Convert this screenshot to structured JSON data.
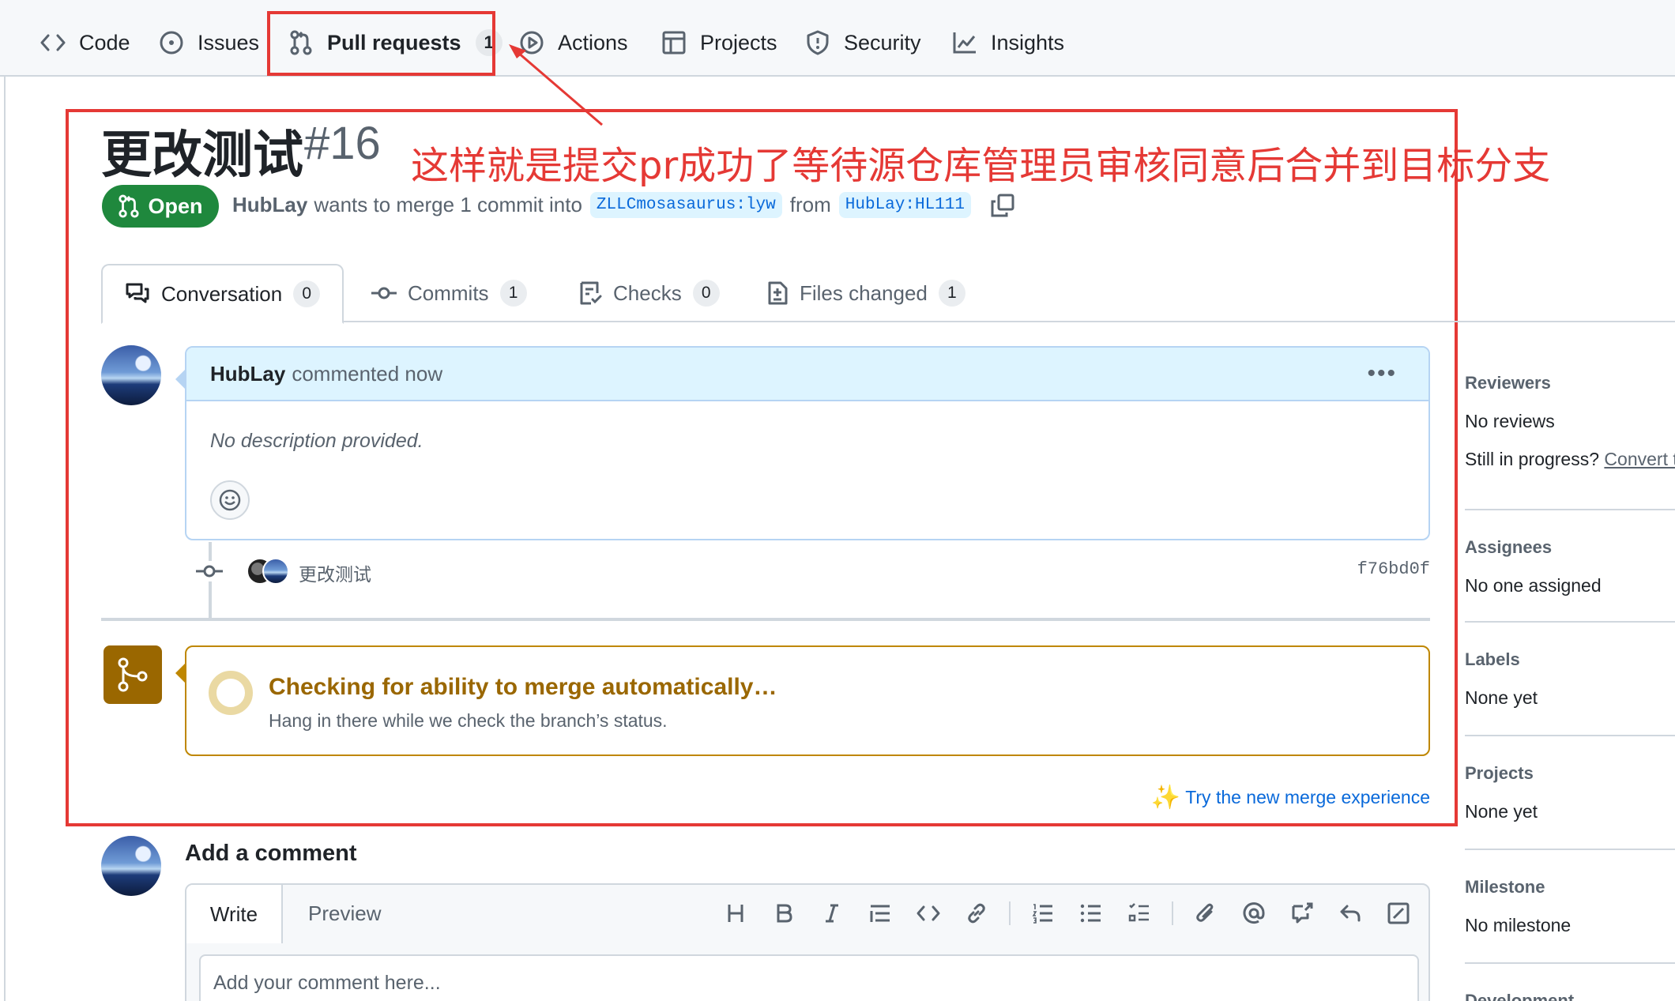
{
  "repo_nav": {
    "items": [
      {
        "label": "Code",
        "icon": "code-icon"
      },
      {
        "label": "Issues",
        "icon": "issue-icon"
      },
      {
        "label": "Pull requests",
        "icon": "pull-request-icon",
        "count": "1",
        "active": true
      },
      {
        "label": "Actions",
        "icon": "play-icon"
      },
      {
        "label": "Projects",
        "icon": "table-icon"
      },
      {
        "label": "Security",
        "icon": "shield-icon"
      },
      {
        "label": "Insights",
        "icon": "graph-icon"
      }
    ]
  },
  "annotation": {
    "text": "这样就是提交pr成功了等待源仓库管理员审核同意后合并到目标分支",
    "color": "#e53935"
  },
  "pr": {
    "title": "更改测试",
    "number": "#16",
    "state": "Open",
    "author": "HubLay",
    "merge_text": "wants to merge 1 commit into",
    "base_branch": "ZLLCmosasaurus:lyw",
    "from_text": "from",
    "head_branch": "HubLay:HL111"
  },
  "tabs": [
    {
      "label": "Conversation",
      "count": "0",
      "icon": "comment-discussion-icon"
    },
    {
      "label": "Commits",
      "count": "1",
      "icon": "commit-icon"
    },
    {
      "label": "Checks",
      "count": "0",
      "icon": "checklist-icon"
    },
    {
      "label": "Files changed",
      "count": "1",
      "icon": "file-diff-icon"
    }
  ],
  "comment": {
    "author": "HubLay",
    "meta": "commented now",
    "body": "No description provided."
  },
  "commit": {
    "message": "更改测试",
    "sha": "f76bd0f"
  },
  "merge_status": {
    "title": "Checking for ability to merge automatically…",
    "subtitle": "Hang in there while we check the branch’s status.",
    "color": "#9a6700"
  },
  "try_new": "Try the new merge experience",
  "add_comment": {
    "title": "Add a comment",
    "write_tab": "Write",
    "preview_tab": "Preview",
    "placeholder": "Add your comment here..."
  },
  "sidebar": {
    "reviewers": {
      "heading": "Reviewers",
      "value": "No reviews",
      "extra_text": "Still in progress?",
      "extra_link": "Convert to draft"
    },
    "assignees": {
      "heading": "Assignees",
      "value": "No one assigned"
    },
    "labels": {
      "heading": "Labels",
      "value": "None yet"
    },
    "projects": {
      "heading": "Projects",
      "value": "None yet"
    },
    "milestone": {
      "heading": "Milestone",
      "value": "No milestone"
    },
    "development": {
      "heading": "Development"
    }
  },
  "colors": {
    "open_green": "#1f883d",
    "link_blue": "#0969da",
    "header_blue": "#ddf4ff"
  }
}
